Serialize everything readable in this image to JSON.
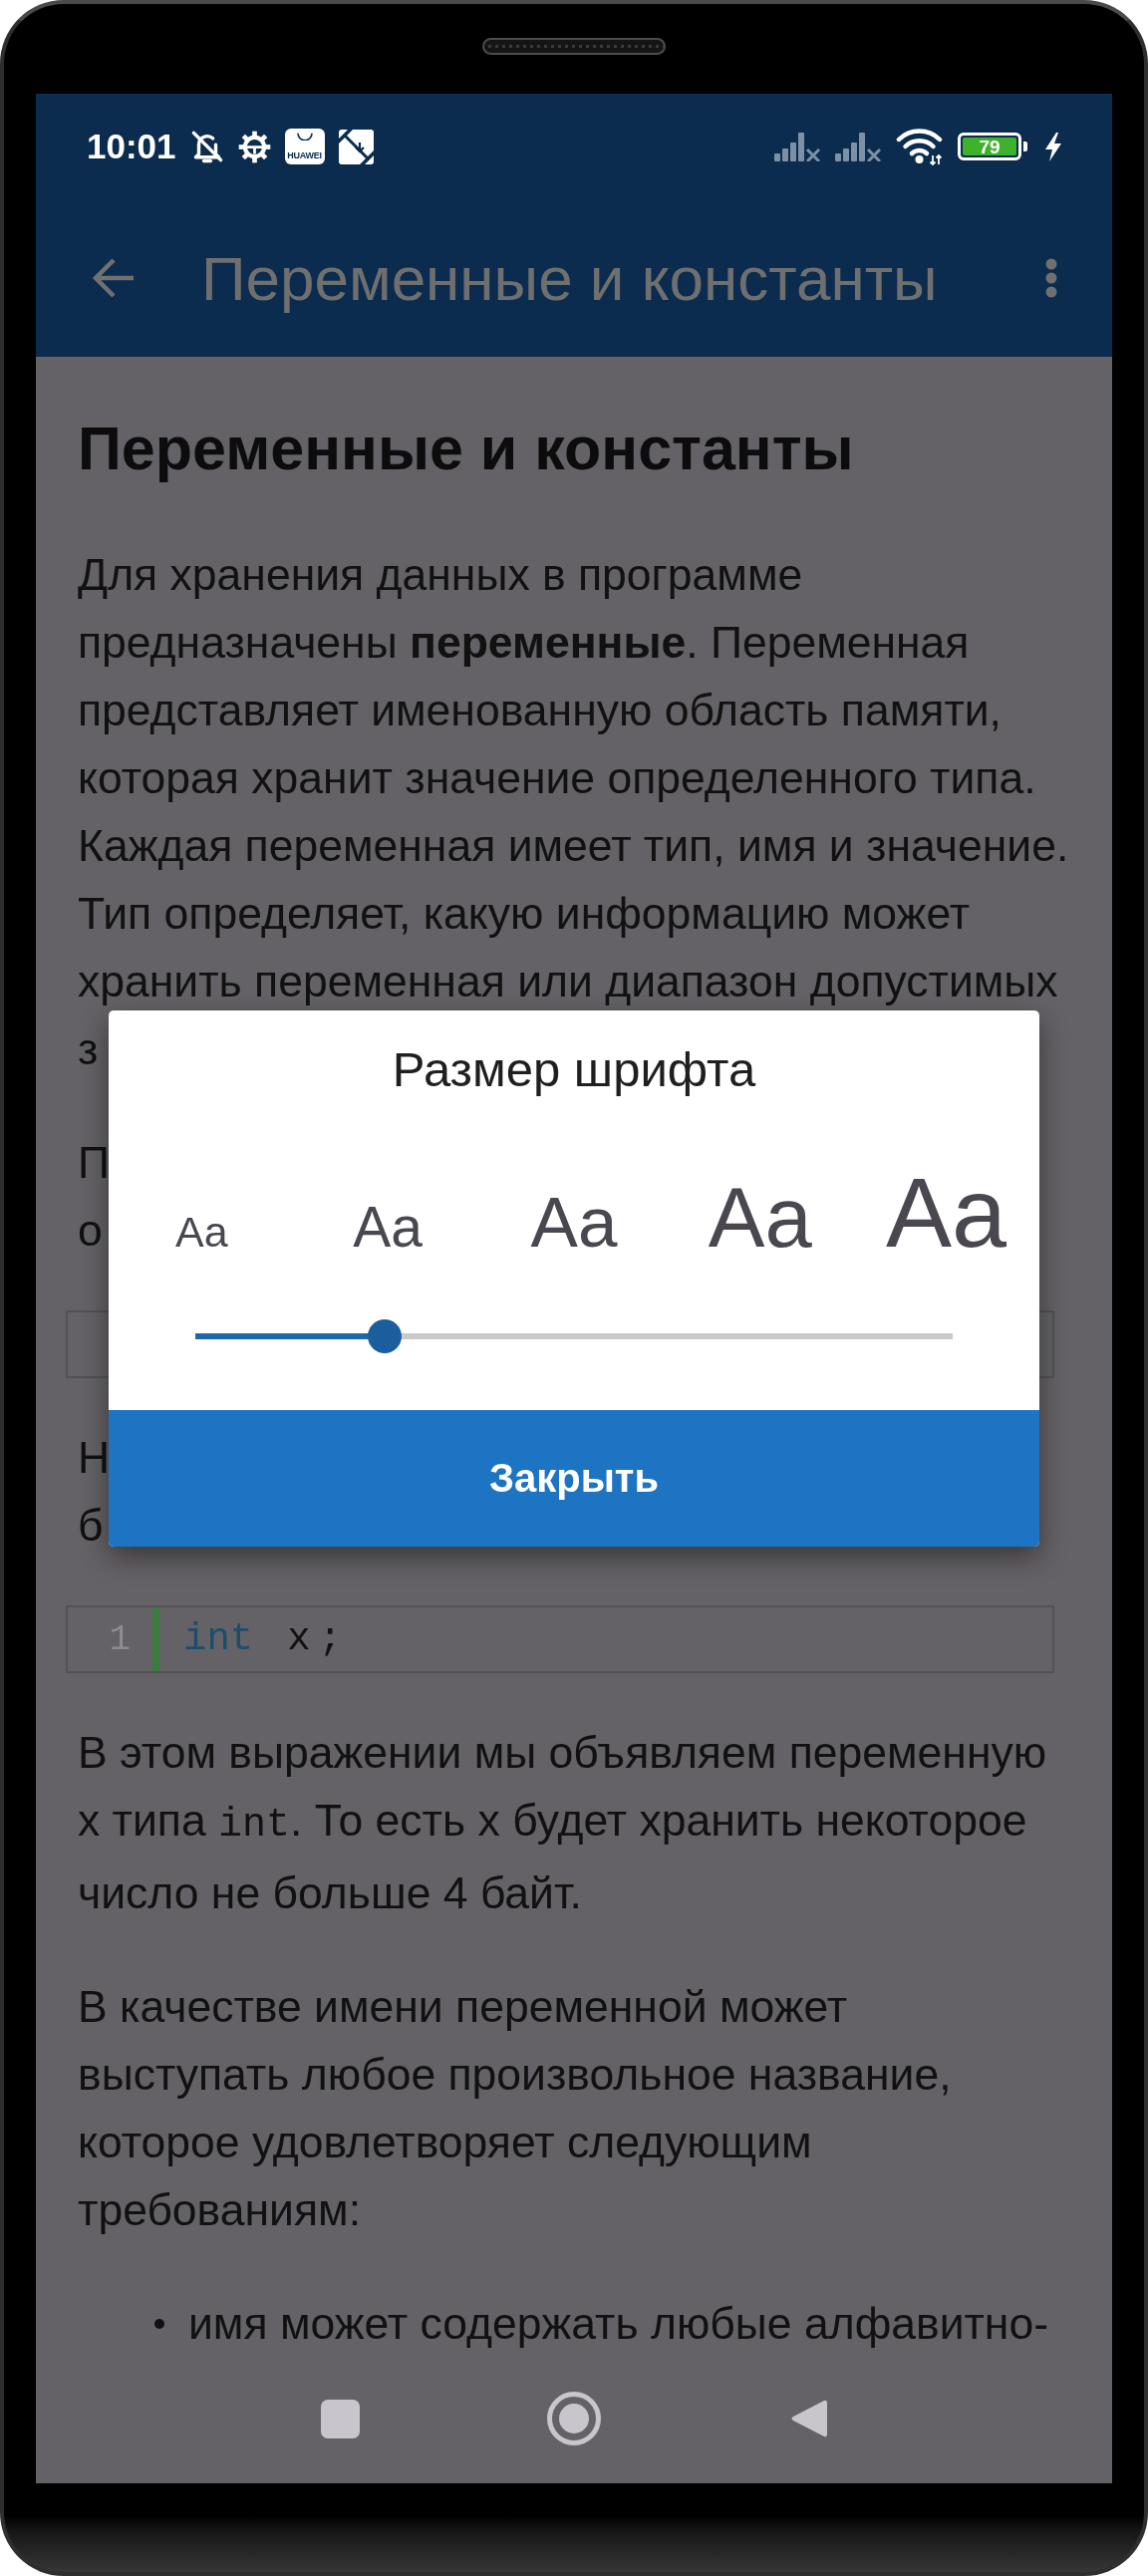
{
  "status_bar": {
    "time": "10:01",
    "app_tile_label": "HUAWEI",
    "battery": "79"
  },
  "app_bar": {
    "title": "Переменные и константы"
  },
  "article": {
    "heading": "Переменные и константы",
    "blocks": [
      {
        "kind": "paragraph",
        "lines": [
          [
            {
              "kind": "text",
              "text": "Для хранения данных в программе"
            }
          ],
          [
            {
              "kind": "text",
              "text": "предназначены "
            },
            {
              "kind": "bold",
              "text": "переменные"
            },
            {
              "kind": "text",
              "text": ". Переменная"
            }
          ],
          [
            {
              "kind": "text",
              "text": "представляет именованную область памяти,"
            }
          ],
          [
            {
              "kind": "text",
              "text": "которая хранит значение определенного типа."
            }
          ],
          [
            {
              "kind": "text",
              "text": "Каждая переменная имеет тип, имя и значение."
            }
          ],
          [
            {
              "kind": "text",
              "text": "Тип определяет, какую информацию может"
            }
          ],
          [
            {
              "kind": "text",
              "text": "хранить переменная или диапазон допустимых"
            }
          ]
        ]
      },
      {
        "kind": "fragment",
        "lines": [
          [
            {
              "kind": "text",
              "text": "з"
            }
          ]
        ]
      },
      {
        "kind": "paragraph",
        "lines": [
          [
            {
              "kind": "text",
              "text": "П"
            }
          ],
          [
            {
              "kind": "text",
              "text": "о"
            }
          ]
        ]
      },
      {
        "kind": "code"
      },
      {
        "kind": "paragraph",
        "lines": [
          [
            {
              "kind": "text",
              "text": "Н"
            }
          ],
          [
            {
              "kind": "text",
              "text": "б"
            }
          ]
        ]
      },
      {
        "kind": "code",
        "lines": [
          {
            "number": "1",
            "tokens": [
              {
                "kind": "keyword",
                "text": "int"
              },
              {
                "kind": "plain",
                "text": "x;"
              }
            ]
          }
        ]
      },
      {
        "kind": "paragraph",
        "lines": [
          [
            {
              "kind": "text",
              "text": "В этом выражении мы объявляем переменную"
            }
          ],
          [
            {
              "kind": "text",
              "text": "x типа "
            },
            {
              "kind": "code",
              "text": "int"
            },
            {
              "kind": "text",
              "text": ". То есть x будет хранить некоторое"
            }
          ],
          [
            {
              "kind": "text",
              "text": "число не больше 4 байт."
            }
          ]
        ]
      },
      {
        "kind": "paragraph",
        "lines": [
          [
            {
              "kind": "text",
              "text": "В качестве имени переменной может"
            }
          ],
          [
            {
              "kind": "text",
              "text": "выступать любое произвольное название,"
            }
          ],
          [
            {
              "kind": "text",
              "text": "которое удовлетворяет следующим"
            }
          ],
          [
            {
              "kind": "text",
              "text": "требованиям:"
            }
          ]
        ]
      },
      {
        "kind": "list",
        "items": [
          "имя может содержать любые алфавитно-"
        ]
      }
    ]
  },
  "dialog": {
    "title": "Размер шрифта",
    "samples": [
      "Aa",
      "Aa",
      "Aa",
      "Aa",
      "Aa"
    ],
    "slider": {
      "level": 0.25
    },
    "button": "Закрыть"
  }
}
